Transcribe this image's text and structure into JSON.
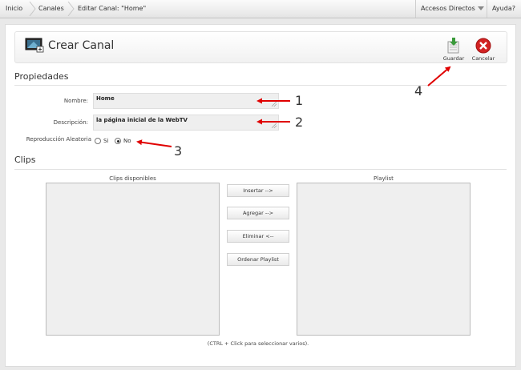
{
  "breadcrumb": [
    "Inicio",
    "Canales",
    "Editar Canal: \"Home\""
  ],
  "topbar": {
    "shortcuts": "Accesos Directos",
    "help": "Ayuda?"
  },
  "header": {
    "title": "Crear Canal"
  },
  "toolbar": {
    "save_label": "Guardar",
    "cancel_label": "Cancelar"
  },
  "sections": {
    "properties": "Propiedades",
    "clips": "Clips"
  },
  "form": {
    "name_label": "Nombre:",
    "name_value": "Home",
    "description_label": "Descripción:",
    "description_value": "la página inicial de la WebTV",
    "shuffle_label": "Reproducción Aleatoria",
    "shuffle_options": [
      "Si",
      "No"
    ],
    "shuffle_selected": "No"
  },
  "clips": {
    "available_label": "Clips disponibles",
    "playlist_label": "Playlist",
    "buttons": [
      "Insertar -->",
      "Agregar -->",
      "Eliminar <--",
      "Ordenar Playlist"
    ],
    "hint": "(CTRL + Click para seleccionar varios)."
  },
  "annotations": [
    "1",
    "2",
    "3",
    "4"
  ],
  "colors": {
    "annotation_arrow": "#e00000",
    "save_icon": "#3a9a3a",
    "cancel_icon": "#d22222"
  }
}
